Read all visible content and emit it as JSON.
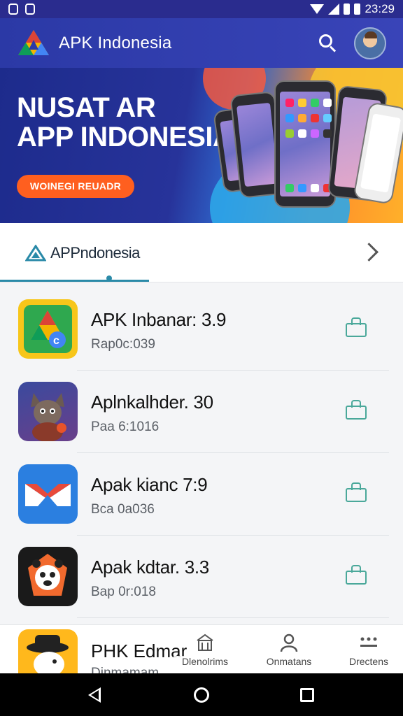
{
  "status_bar": {
    "time": "23:29"
  },
  "app_bar": {
    "title": "APK Indonesia"
  },
  "banner": {
    "headline_line1": "NUSAT AR",
    "headline_line2": "APP INDONESIA",
    "button_label": "WOINEGI REUADR"
  },
  "tabs": {
    "active_label": "APPndonesia"
  },
  "apps": [
    {
      "name": "APK Inbanar: 3.9",
      "meta": "Rap0c:039",
      "icon": "drive-style-icon"
    },
    {
      "name": "Aplnkalhder. 30",
      "meta": "Paa 6:1016",
      "icon": "cartoon-cat-icon"
    },
    {
      "name": "Apak kianc 7:9",
      "meta": "Bca 0a036",
      "icon": "mail-icon"
    },
    {
      "name": "Apak kdtar. 3.3",
      "meta": "Bap 0r:018",
      "icon": "panda-mascot-icon"
    }
  ],
  "peek_app": {
    "name": "PHK Edmar",
    "meta": "Dinmamam"
  },
  "bottom_nav": [
    {
      "label": "Dlenolrims",
      "icon": "store-icon"
    },
    {
      "label": "Onmatans",
      "icon": "account-icon"
    },
    {
      "label": "Drectens",
      "icon": "menu-icon"
    }
  ],
  "colors": {
    "app_bar": "#2b39a6",
    "banner_button": "#ff5f1f",
    "accent": "#2a8aa8",
    "bag_icon": "#4aa89a"
  }
}
